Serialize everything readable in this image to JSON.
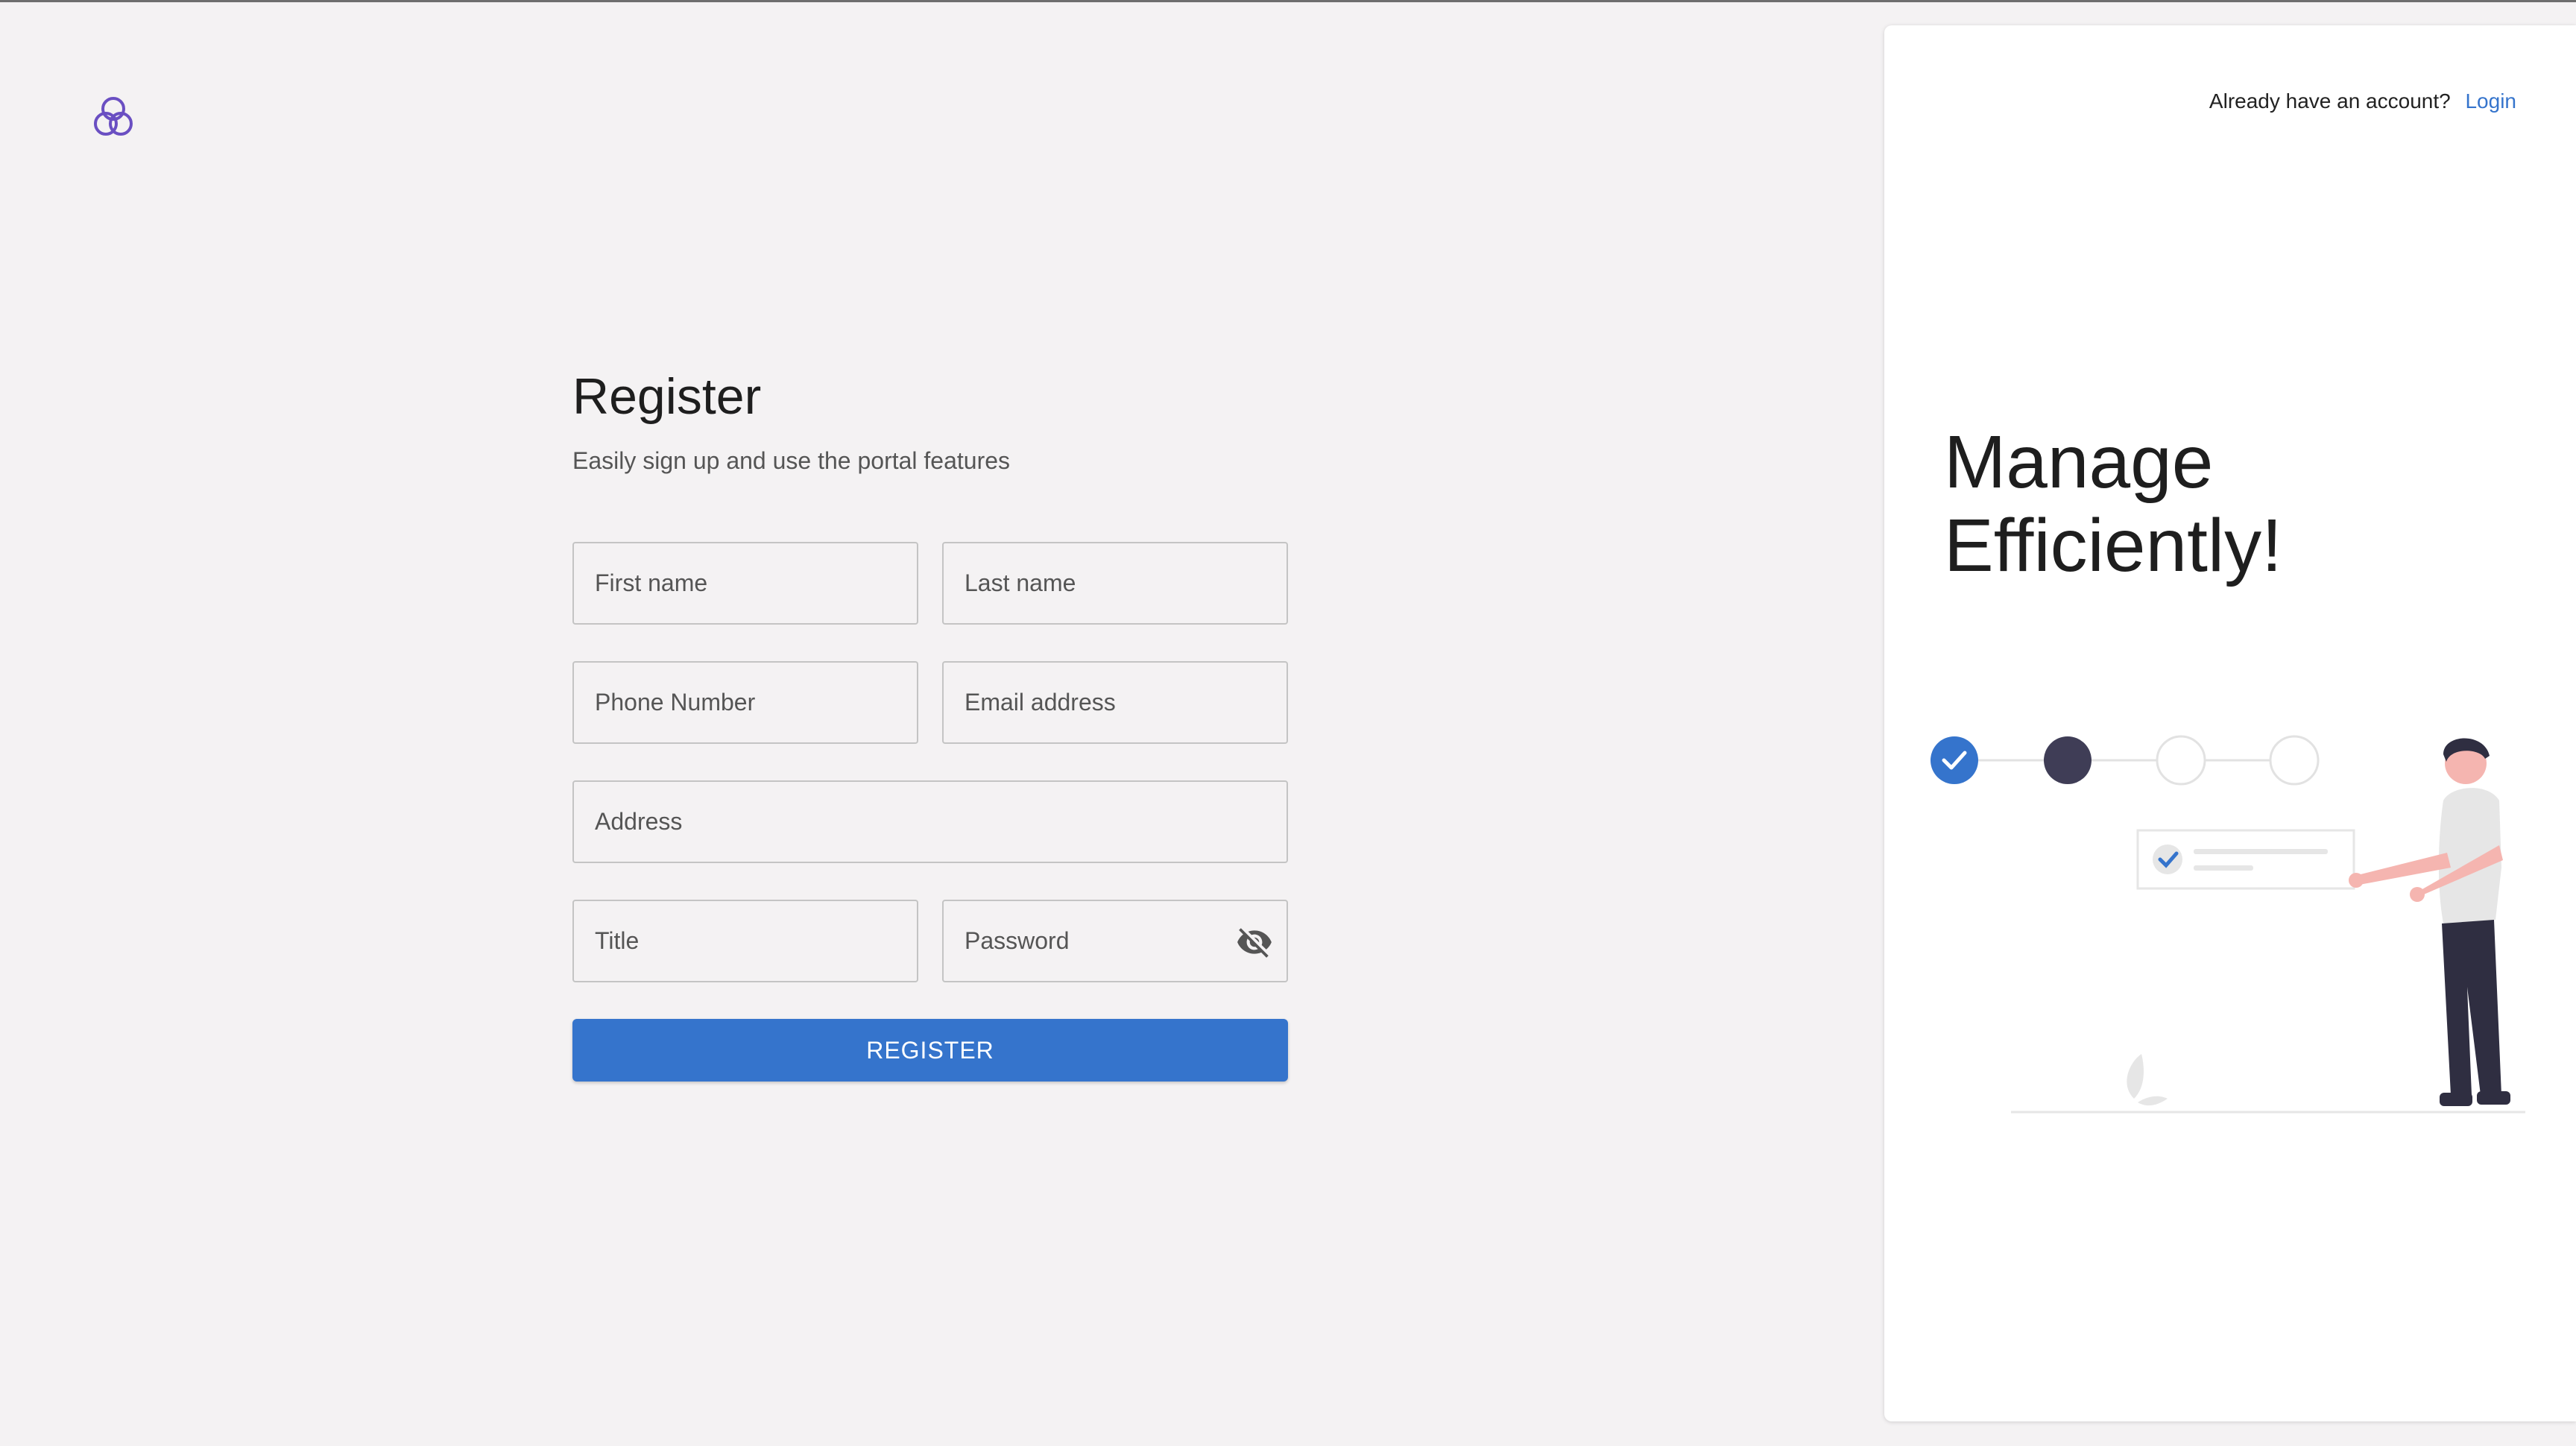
{
  "app": {
    "logo_icon": "logo-icon"
  },
  "form": {
    "title": "Register",
    "subtitle": "Easily sign up and use the portal features",
    "first_name": "First name",
    "last_name": "Last name",
    "phone": "Phone Number",
    "email": "Email address",
    "address": "Address",
    "job_title": "Title",
    "password": "Password",
    "submit_label": "REGISTER"
  },
  "panel": {
    "login_prompt": "Already have an account?",
    "login_link": "Login",
    "hero_line1": "Manage",
    "hero_line2": "Efficiently!"
  },
  "colors": {
    "accent": "#3574cc",
    "background": "#f4f2f3",
    "panel": "#ffffff"
  }
}
